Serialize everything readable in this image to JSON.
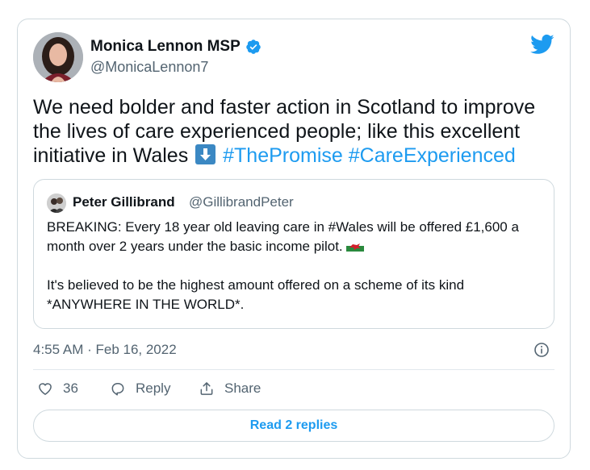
{
  "author": {
    "name": "Monica Lennon MSP",
    "handle": "@MonicaLennon7"
  },
  "tweet": {
    "text_before": "We need bolder and faster action in Scotland to improve the lives of care experienced people; like this excellent initiative in Wales",
    "hashtag_1": "#ThePromise",
    "hashtag_2": "#CareExperienced"
  },
  "quoted_tweet": {
    "name": "Peter Gillibrand",
    "handle": "@GillibrandPeter",
    "paragraph_1": "BREAKING: Every 18 year old leaving care in #Wales will be offered £1,600 a month over 2 years under the basic income pilot.",
    "paragraph_2": "It's believed to be the highest amount offered on a scheme of its kind *ANYWHERE IN THE WORLD*."
  },
  "timestamp": "4:55 AM · Feb 16, 2022",
  "actions": {
    "like_count": "36",
    "reply_label": "Reply",
    "share_label": "Share"
  },
  "read_replies_label": "Read 2 replies",
  "colors": {
    "accent": "#1d9bf0",
    "text": "#0f1419",
    "muted": "#536471",
    "border": "#cfd9de"
  },
  "icons": [
    "verified-badge-icon",
    "twitter-bird-icon",
    "arrow-down-emoji",
    "wales-flag-emoji",
    "info-icon",
    "heart-icon",
    "reply-icon",
    "share-icon"
  ]
}
